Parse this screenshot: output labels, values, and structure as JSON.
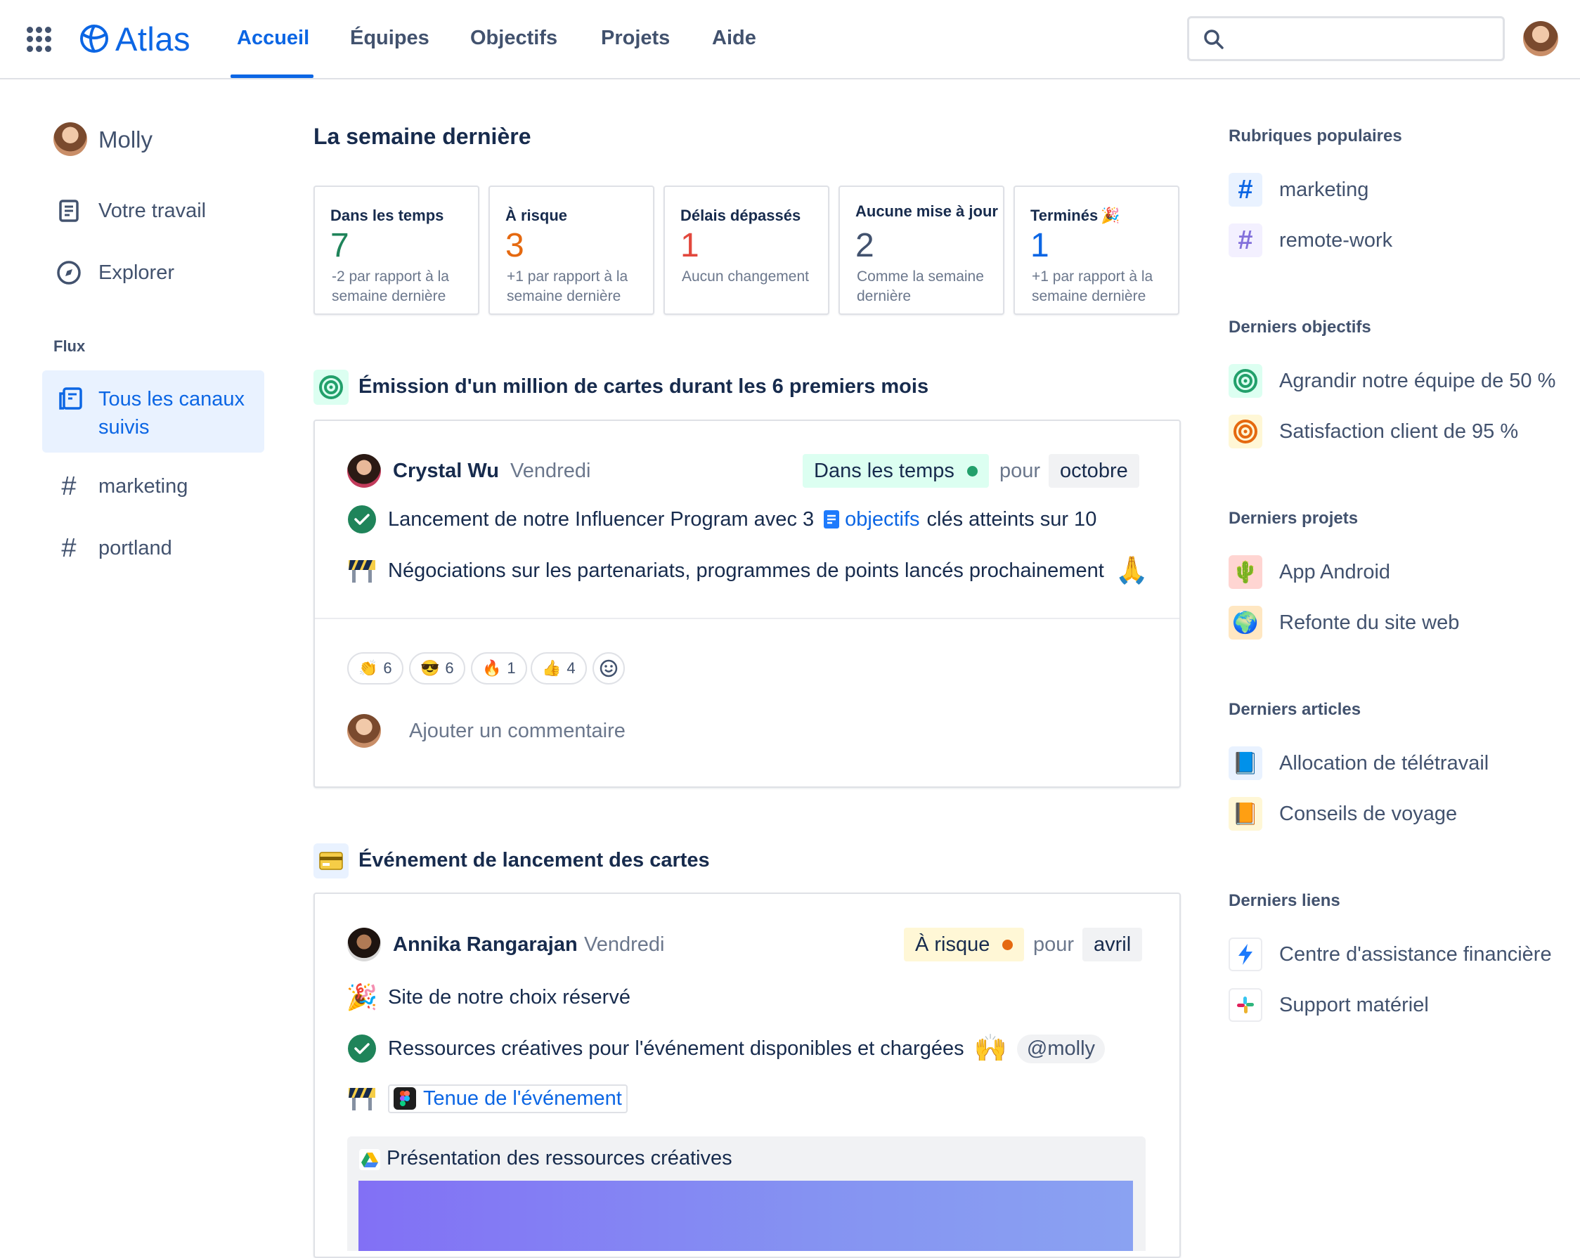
{
  "header": {
    "brand": "Atlas",
    "nav": [
      {
        "label": "Accueil",
        "active": true
      },
      {
        "label": "Équipes"
      },
      {
        "label": "Objectifs"
      },
      {
        "label": "Projets"
      },
      {
        "label": "Aide"
      }
    ],
    "search": {
      "placeholder": ""
    }
  },
  "sidebar": {
    "user": "Molly",
    "items": [
      {
        "label": "Votre travail",
        "icon": "document-icon"
      },
      {
        "label": "Explorer",
        "icon": "compass-icon"
      }
    ],
    "section_title": "Flux",
    "feeds": [
      {
        "label": "Tous les canaux suivis",
        "active": true,
        "icon": "feed-icon"
      },
      {
        "label": "marketing",
        "icon": "hash-icon"
      },
      {
        "label": "portland",
        "icon": "hash-icon"
      }
    ]
  },
  "main": {
    "week_title": "La semaine dernière",
    "stats": [
      {
        "label": "Dans les temps",
        "value": "7",
        "color": "#1F845A",
        "sub": "-2 par rapport à la semaine dernière"
      },
      {
        "label": "À risque",
        "value": "3",
        "color": "#E56910",
        "sub": "+1 par rapport à la semaine dernière"
      },
      {
        "label": "Délais dépassés",
        "value": "1",
        "color": "#E2483D",
        "sub": "Aucun changement"
      },
      {
        "label": "Aucune mise à jour",
        "value": "2",
        "color": "#42526E",
        "sub": "Comme la semaine dernière"
      },
      {
        "label": "Terminés",
        "emoji": "🎉",
        "value": "1",
        "color": "#0C66E4",
        "sub": "+1 par rapport à la semaine dernière"
      }
    ],
    "goal1": {
      "title": "Émission d'un million de cartes durant les 6 premiers mois",
      "author": "Crystal Wu",
      "day": "Vendredi",
      "status": "Dans les temps",
      "status_color": "#1F845A",
      "pour": "pour",
      "month": "octobre",
      "line1_pre": "Lancement de notre Influencer Program avec 3",
      "line1_link": "objectifs",
      "line1_post": "clés atteints sur 10",
      "line2": "Négociations sur les partenariats, programmes de points lancés prochainement",
      "reactions": [
        {
          "emoji": "👏",
          "count": "6"
        },
        {
          "emoji": "😎",
          "count": "6"
        },
        {
          "emoji": "🔥",
          "count": "1"
        },
        {
          "emoji": "👍",
          "count": "4"
        }
      ],
      "comment_placeholder": "Ajouter un commentaire"
    },
    "goal2": {
      "title": "Événement de lancement des cartes",
      "author": "Annika Rangarajan",
      "day": "Vendredi",
      "status": "À risque",
      "status_color": "#E56910",
      "pour": "pour",
      "month": "avril",
      "line1": "Site de notre choix réservé",
      "line2": "Ressources créatives pour l'événement disponibles et chargées",
      "mention": "@molly",
      "line3_link": "Tenue de l'événement",
      "attachment_title": "Présentation des ressources créatives"
    }
  },
  "right": {
    "topics_title": "Rubriques populaires",
    "topics": [
      "marketing",
      "remote-work"
    ],
    "goals_title": "Derniers objectifs",
    "goals": [
      {
        "label": "Agrandir notre équipe de 50 %",
        "color": "#1F845A"
      },
      {
        "label": "Satisfaction client de 95 %",
        "color": "#E56910"
      }
    ],
    "projects_title": "Derniers projets",
    "projects": [
      {
        "label": "App Android",
        "emoji": "🌵"
      },
      {
        "label": "Refonte du site web",
        "emoji": "🌍"
      }
    ],
    "articles_title": "Derniers articles",
    "articles": [
      {
        "label": "Allocation de télétravail",
        "emoji": "📘"
      },
      {
        "label": "Conseils de voyage",
        "emoji": "📙"
      }
    ],
    "links_title": "Derniers liens",
    "links": [
      {
        "label": "Centre d'assistance financière",
        "icon": "lightning-icon"
      },
      {
        "label": "Support matériel",
        "icon": "slack-icon"
      }
    ]
  }
}
